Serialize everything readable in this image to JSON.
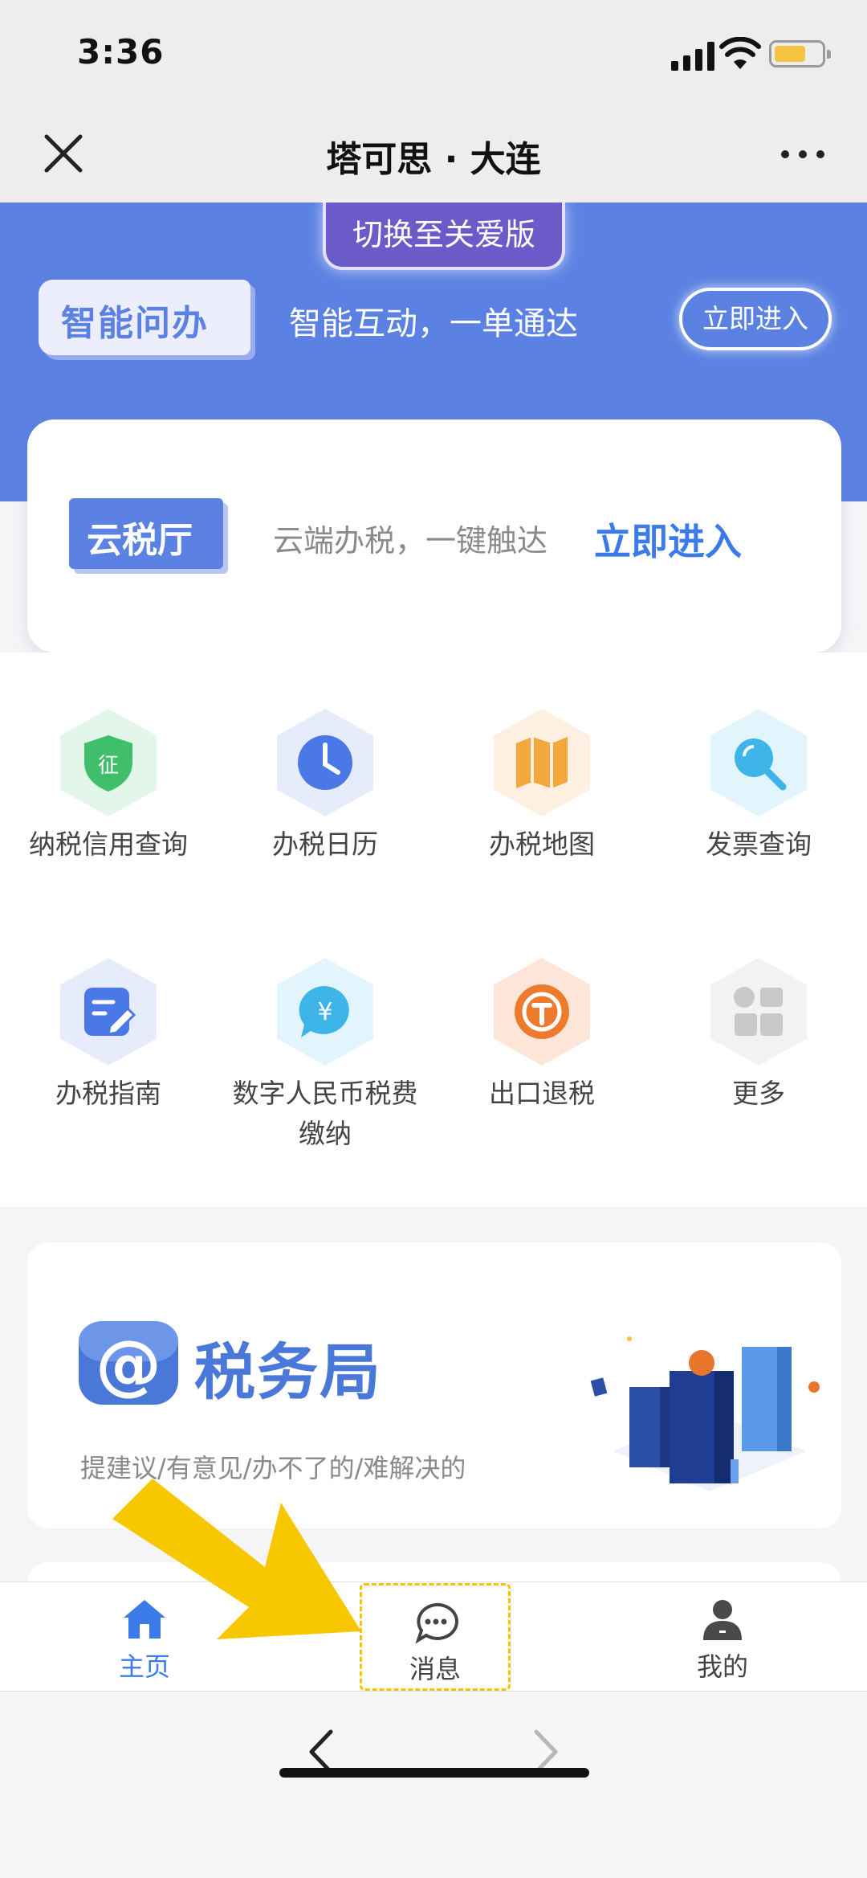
{
  "status_bar": {
    "time": "3:36"
  },
  "nav": {
    "title": "塔可思 · 大连"
  },
  "hero": {
    "care_switch": "切换至关爱版",
    "smart_badge": "智能问办",
    "smart_text": "智能互动，一单通达",
    "enter_label": "立即进入"
  },
  "cloud_card": {
    "logo_text": "云税厅",
    "desc": "云端办税，一键触达",
    "enter_label": "立即进入"
  },
  "services": [
    {
      "label": "纳税信用查询",
      "icon": "credit-shield-icon",
      "color": "#3fbf6b"
    },
    {
      "label": "办税日历",
      "icon": "clock-icon",
      "color": "#4a78e6"
    },
    {
      "label": "办税地图",
      "icon": "map-icon",
      "color": "#f4a73a"
    },
    {
      "label": "发票查询",
      "icon": "search-icon",
      "color": "#3fb4e8"
    },
    {
      "label": "办税指南",
      "icon": "edit-guide-icon",
      "color": "#4a78e6"
    },
    {
      "label": "数字人民币税费缴纳",
      "icon": "yuan-chat-icon",
      "color": "#3fb4e8"
    },
    {
      "label": "出口退税",
      "icon": "refund-icon",
      "color": "#ee7a2e"
    },
    {
      "label": "更多",
      "icon": "more-grid-icon",
      "color": "#c9c9c9"
    }
  ],
  "bureau_card": {
    "title": "税务局",
    "subtitle": "提建议/有意见/办不了的/难解决的"
  },
  "tabs": [
    {
      "label": "主页",
      "icon": "home-icon",
      "active": true
    },
    {
      "label": "消息",
      "icon": "message-icon",
      "active": false
    },
    {
      "label": "我的",
      "icon": "profile-icon",
      "active": false
    }
  ],
  "colors": {
    "brand_blue": "#5b82e3",
    "active_tab": "#3b7be9",
    "highlight": "#f5c400"
  }
}
